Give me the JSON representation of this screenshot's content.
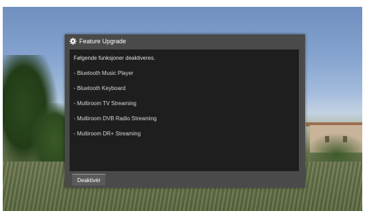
{
  "dialog": {
    "title": "Feature Upgrade",
    "icon": "gear-icon",
    "intro": "Følgende funksjoner deaktiveres.",
    "features": [
      "- Bluetooth Music Player",
      "- Bluetooth Keyboard",
      "- Multiroom TV Streaming",
      "- Multiroom DVB Radio Streaming",
      "- Multiroom DR+ Streaming"
    ],
    "button_label": "Deaktivér"
  },
  "colors": {
    "dialog_frame": "#4a4a4a",
    "dialog_body": "#1e1e1e",
    "button": "#5a5a5a",
    "text": "#ffffff"
  }
}
